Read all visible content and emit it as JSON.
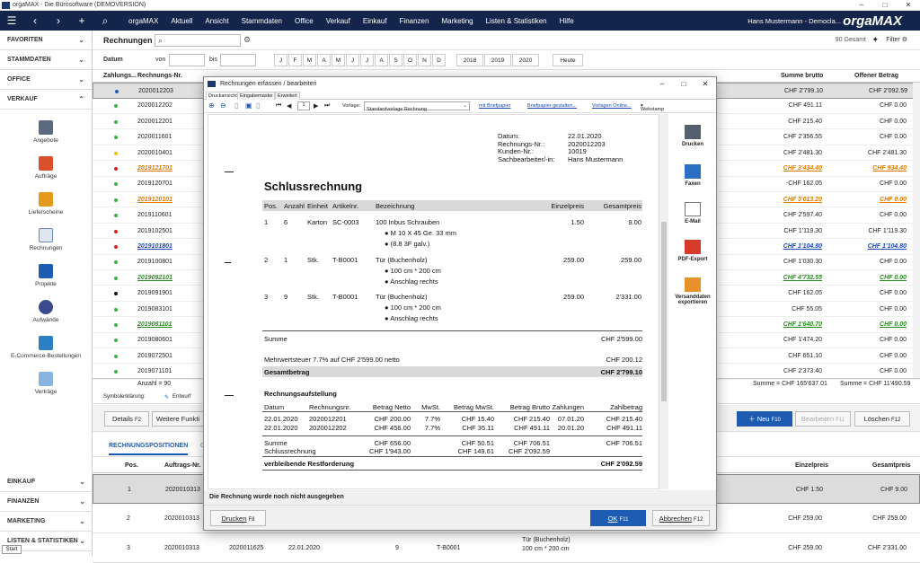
{
  "window": {
    "title": "orgaMAX - Die Bürosoftware (DEMOVERSION)"
  },
  "menubar": {
    "brand": "orgaMAX",
    "items": [
      "Aktuell",
      "Ansicht",
      "Stammdaten",
      "Office",
      "Verkauf",
      "Einkauf",
      "Finanzen",
      "Marketing",
      "Listen & Statistiken",
      "Hilfe"
    ],
    "user": "Hans Mustermann - Democla...",
    "logo": "orgaMAX"
  },
  "sidebar": {
    "heads_top": [
      "FAVORITEN",
      "STAMMDATEN",
      "OFFICE",
      "VERKAUF"
    ],
    "items": [
      "Angebote",
      "Aufträge",
      "Lieferscheine",
      "Rechnungen",
      "Projekte",
      "Aufwände",
      "E-Commerce-Bestellungen",
      "Verträge"
    ],
    "heads_bottom": [
      "EINKAUF",
      "FINANZEN",
      "MARKETING",
      "LISTEN & STATISTIKEN"
    ],
    "start": "Start"
  },
  "toolbar": {
    "title": "Rechnungen",
    "count": "90 Gesamt",
    "filter": "Filter",
    "datum_label": "Datum",
    "von": "von",
    "bis": "bis",
    "months": [
      "J",
      "F",
      "M",
      "A",
      "M",
      "J",
      "J",
      "A",
      "S",
      "O",
      "N",
      "D"
    ],
    "years": [
      "2018",
      "2019",
      "2020"
    ],
    "today": "Heute"
  },
  "grid": {
    "headers": {
      "status": "Zahlungs...",
      "nr": "Rechnungs-Nr.",
      "brutto": "Summe brutto",
      "offen": "Offener Betrag"
    },
    "rows": [
      {
        "nr": "2020012203",
        "style": "",
        "dot": "#1e5cb3",
        "brutto": "CHF 2'799.10",
        "offen": "CHF 2'092.59",
        "sel": true
      },
      {
        "nr": "2020012202",
        "style": "",
        "dot": "#3cb043",
        "brutto": "CHF 491.11",
        "offen": "CHF 0.00"
      },
      {
        "nr": "2020012201",
        "style": "",
        "dot": "#3cb043",
        "brutto": "CHF 215.40",
        "offen": "CHF 0.00"
      },
      {
        "nr": "2020011601",
        "style": "",
        "dot": "#3cb043",
        "brutto": "CHF 2'356.55",
        "offen": "CHF 0.00"
      },
      {
        "nr": "2020010401",
        "style": "",
        "dot": "#f2c200",
        "brutto": "CHF 2'481.30",
        "offen": "CHF 2'481.30"
      },
      {
        "nr": "2019121701",
        "style": "orange",
        "dot": "#d62020",
        "brutto": "CHF 3'434.40",
        "offen": "CHF 934.40"
      },
      {
        "nr": "2019120701",
        "style": "",
        "dot": "#3cb043",
        "brutto": "-CHF 162.05",
        "offen": "CHF 0.00"
      },
      {
        "nr": "2019120101",
        "style": "orange",
        "dot": "#3cb043",
        "brutto": "CHF 3'013.20",
        "offen": "CHF 0.00"
      },
      {
        "nr": "2019110601",
        "style": "",
        "dot": "#3cb043",
        "brutto": "CHF 2'597.40",
        "offen": "CHF 0.00"
      },
      {
        "nr": "2019102501",
        "style": "",
        "dot": "#d62020",
        "brutto": "CHF 1'119.30",
        "offen": "CHF 1'119.30"
      },
      {
        "nr": "2019101801",
        "style": "blue",
        "dot": "#d62020",
        "brutto": "CHF 1'104.80",
        "offen": "CHF 1'104.80"
      },
      {
        "nr": "2019100801",
        "style": "",
        "dot": "#3cb043",
        "brutto": "CHF 1'030.30",
        "offen": "CHF 0.00"
      },
      {
        "nr": "2019092101",
        "style": "green",
        "dot": "#3cb043",
        "brutto": "CHF 4'732.55",
        "offen": "CHF 0.00"
      },
      {
        "nr": "2019091901",
        "style": "",
        "dot": "#111111",
        "brutto": "CHF 162.05",
        "offen": "CHF 0.00"
      },
      {
        "nr": "2019083101",
        "style": "",
        "dot": "#3cb043",
        "brutto": "CHF 55.05",
        "offen": "CHF 0.00"
      },
      {
        "nr": "2019081101",
        "style": "green",
        "dot": "#3cb043",
        "brutto": "CHF 1'640.70",
        "offen": "CHF 0.00"
      },
      {
        "nr": "2019080601",
        "style": "",
        "dot": "#3cb043",
        "brutto": "CHF 1'474.20",
        "offen": "CHF 0.00"
      },
      {
        "nr": "2019072501",
        "style": "",
        "dot": "#3cb043",
        "brutto": "CHF 651.10",
        "offen": "CHF 0.00"
      },
      {
        "nr": "2019071101",
        "style": "",
        "dot": "#3cb043",
        "brutto": "CHF 2'373.40",
        "offen": "CHF 0.00"
      }
    ],
    "count": "Anzahl = 90",
    "sum_brutto": "Summe = CHF 165'637.01",
    "sum_offen": "Summe = CHF 11'490.59",
    "legend_label": "Symbolerklärung:",
    "legend_entwurf": "Entwurf"
  },
  "actions": {
    "details": "Details",
    "details_key": "F2",
    "weitere": "Weitere Funkti",
    "neu": "Neu",
    "neu_key": "F10",
    "bearbeiten": "Bearbeiten",
    "bearbeiten_key": "F11",
    "loeschen": "Löschen",
    "loeschen_key": "F12"
  },
  "positions": {
    "tab": "RECHNUNGSPOSITIONEN",
    "tab2": "G",
    "headers": {
      "pos": "Pos.",
      "auftrag": "Auftrags-Nr.",
      "einzel": "Einzelpreis",
      "gesamt": "Gesamtpreis"
    },
    "rows": [
      {
        "pos": "1",
        "auftrag": "2020010313",
        "einzel": "CHF 1.50",
        "gesamt": "CHF 9.00",
        "sel": true
      },
      {
        "pos": "2",
        "auftrag": "2020010313",
        "einzel": "CHF 259.00",
        "gesamt": "CHF 259.00"
      },
      {
        "pos": "3",
        "auftrag": "2020010313",
        "einzel": "CHF 259.00",
        "gesamt": "CHF 2'331.00",
        "extra": "2020011625",
        "date": "22.01.2020",
        "qty": "9",
        "art": "T-B0001",
        "desc1": "Tür (Buchenholz)",
        "desc2": "100 cm * 200 cm"
      }
    ]
  },
  "dialog": {
    "title": "Rechnungen erfassen / bearbeiten",
    "tabs": [
      "Druckansicht",
      "Eingabemaske",
      "Erweitert"
    ],
    "page": "1",
    "vorlage_label": "Vorlage:",
    "vorlage_value": "Standardvorlage Rechnung",
    "links": [
      "mit Briefpapier",
      "Briefpapier gestalten...",
      "Vorlagen Online..."
    ],
    "webstamp": "Webstamp",
    "side": [
      "Drucken",
      "Faxen",
      "E-Mail",
      "PDF-Export",
      "Versanddaten exportieren"
    ],
    "status": "Die Rechnung wurde noch nicht ausgegeben",
    "btn_drucken": "Drucken",
    "btn_drucken_key": "F8",
    "btn_ok": "OK",
    "btn_ok_key": "F11",
    "btn_abbrechen": "Abbrechen",
    "btn_abbrechen_key": "F12"
  },
  "invoice": {
    "meta_labels": [
      "Datum:",
      "Rechnungs-Nr.:",
      "Kunden-Nr.:",
      "Sachbearbeiter/-in:"
    ],
    "meta_values": [
      "22.01.2020",
      "2020012203",
      "10019",
      "Hans Mustermann"
    ],
    "heading": "Schlussrechnung",
    "cols": [
      "Pos.",
      "Anzahl",
      "Einheit",
      "Artikelnr.",
      "Bezeichnung",
      "Einzelpreis",
      "Gesamtpreis"
    ],
    "lines": [
      {
        "pos": "1",
        "qty": "6",
        "unit": "Karton",
        "art": "SC-0003",
        "desc": "100 Inbus Schrauben",
        "bullets": [
          "M 10 X 45 Ge. 33 mm",
          "(8.8 3F galv.)"
        ],
        "price": "1.50",
        "total": "9.00"
      },
      {
        "pos": "2",
        "qty": "1",
        "unit": "Stk.",
        "art": "T-B0001",
        "desc": "Tür (Buchenholz)",
        "bullets": [
          "100 cm * 200 cm",
          "Anschlag rechts"
        ],
        "price": "259.00",
        "total": "259.00"
      },
      {
        "pos": "3",
        "qty": "9",
        "unit": "Stk.",
        "art": "T-B0001",
        "desc": "Tür (Buchenholz)",
        "bullets": [
          "100 cm * 200 cm",
          "Anschlag rechts"
        ],
        "price": "259.00",
        "total": "2'331.00"
      }
    ],
    "summe_label": "Summe",
    "summe": "CHF 2'599.00",
    "mwst_label": "Mehrwertsteuer 7.7% auf CHF 2'599.00 netto",
    "mwst": "CHF 200.12",
    "gesamt_label": "Gesamtbetrag",
    "gesamt": "CHF 2'799.10",
    "auf_heading": "Rechnungsaufstellung",
    "auf_cols": [
      "Datum",
      "Rechnungsnr.",
      "Betrag Netto",
      "MwSt.",
      "Betrag MwSt.",
      "Betrag Brutto",
      "Zahlungen",
      "Zahlbetrag"
    ],
    "auf_rows": [
      [
        "22.01.2020",
        "2020012201",
        "CHF 200.00",
        "7.7%",
        "CHF 15.40",
        "CHF 215.40",
        "07.01.20",
        "CHF 215.40"
      ],
      [
        "22.01.2020",
        "2020012202",
        "CHF 456.00",
        "7.7%",
        "CHF 35.11",
        "CHF 491.11",
        "20.01.20",
        "CHF 491.11"
      ]
    ],
    "auf_summe": [
      "Summe",
      "CHF 656.00",
      "CHF 50.51",
      "CHF 706.51",
      "CHF 706.51"
    ],
    "auf_schluss": [
      "Schlussrechnung",
      "CHF 1'943.00",
      "CHF 149.61",
      "CHF 2'092.59"
    ],
    "rest_label": "verbleibende Restforderung",
    "rest": "CHF 2'092.59"
  }
}
